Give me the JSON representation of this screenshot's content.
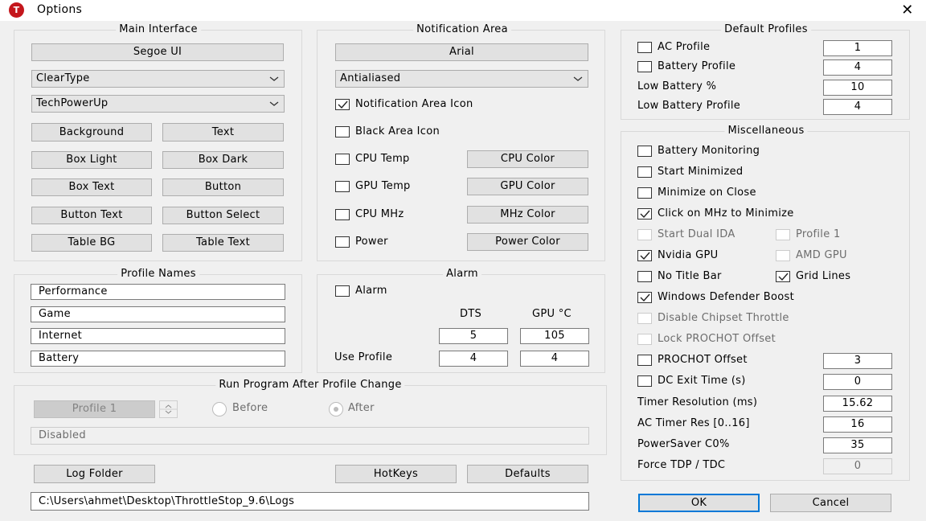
{
  "window": {
    "title": "Options",
    "app_icon": "T",
    "close": "✕"
  },
  "main_interface": {
    "legend": "Main Interface",
    "font_button": "Segoe UI",
    "rendering": "ClearType",
    "theme": "TechPowerUp",
    "color_buttons": [
      "Background",
      "Text",
      "Box Light",
      "Box Dark",
      "Box Text",
      "Button",
      "Button Text",
      "Button Select",
      "Table BG",
      "Table Text"
    ]
  },
  "notification_area": {
    "legend": "Notification Area",
    "font_button": "Arial",
    "rendering": "Antialiased",
    "notification_icon": "Notification Area Icon",
    "black_icon": "Black Area Icon",
    "cpu_temp": "CPU Temp",
    "cpu_color": "CPU Color",
    "gpu_temp": "GPU Temp",
    "gpu_color": "GPU Color",
    "cpu_mhz": "CPU MHz",
    "mhz_color": "MHz Color",
    "power": "Power",
    "power_color": "Power Color"
  },
  "profile_names": {
    "legend": "Profile Names",
    "names": [
      "Performance",
      "Game",
      "Internet",
      "Battery"
    ]
  },
  "alarm": {
    "legend": "Alarm",
    "alarm_label": "Alarm",
    "col_dts": "DTS",
    "col_gpu": "GPU °C",
    "dts_value": "5",
    "gpu_value": "105",
    "use_profile": "Use Profile",
    "dts_profile": "4",
    "gpu_profile": "4"
  },
  "run_program": {
    "legend": "Run Program After Profile Change",
    "profile_button": "Profile 1",
    "before": "Before",
    "after": "After",
    "path": "Disabled"
  },
  "bottom": {
    "log_folder": "Log Folder",
    "hotkeys": "HotKeys",
    "defaults": "Defaults",
    "log_path": "C:\\Users\\ahmet\\Desktop\\ThrottleStop_9.6\\Logs",
    "ok": "OK",
    "cancel": "Cancel"
  },
  "default_profiles": {
    "legend": "Default Profiles",
    "ac_profile": "AC Profile",
    "ac_value": "1",
    "battery_profile": "Battery Profile",
    "battery_value": "4",
    "low_battery_pct": "Low Battery %",
    "low_battery_pct_value": "10",
    "low_battery_profile": "Low Battery Profile",
    "low_battery_profile_value": "4"
  },
  "misc": {
    "legend": "Miscellaneous",
    "battery_monitoring": "Battery Monitoring",
    "start_minimized": "Start Minimized",
    "minimize_on_close": "Minimize on Close",
    "click_mhz": "Click on MHz to Minimize",
    "start_dual_ida": "Start Dual IDA",
    "profile_1": "Profile 1",
    "nvidia_gpu": "Nvidia GPU",
    "amd_gpu": "AMD GPU",
    "no_title_bar": "No Title Bar",
    "grid_lines": "Grid Lines",
    "defender_boost": "Windows Defender Boost",
    "disable_chipset": "Disable Chipset Throttle",
    "lock_prochot": "Lock PROCHOT Offset",
    "prochot_offset": "PROCHOT Offset",
    "prochot_value": "3",
    "dc_exit": "DC Exit Time (s)",
    "dc_exit_value": "0",
    "timer_res": "Timer Resolution (ms)",
    "timer_res_value": "15.62",
    "ac_timer": "AC Timer Res [0..16]",
    "ac_timer_value": "16",
    "powersaver": "PowerSaver C0%",
    "powersaver_value": "35",
    "force_tdp": "Force TDP / TDC",
    "force_tdp_value": "0"
  }
}
